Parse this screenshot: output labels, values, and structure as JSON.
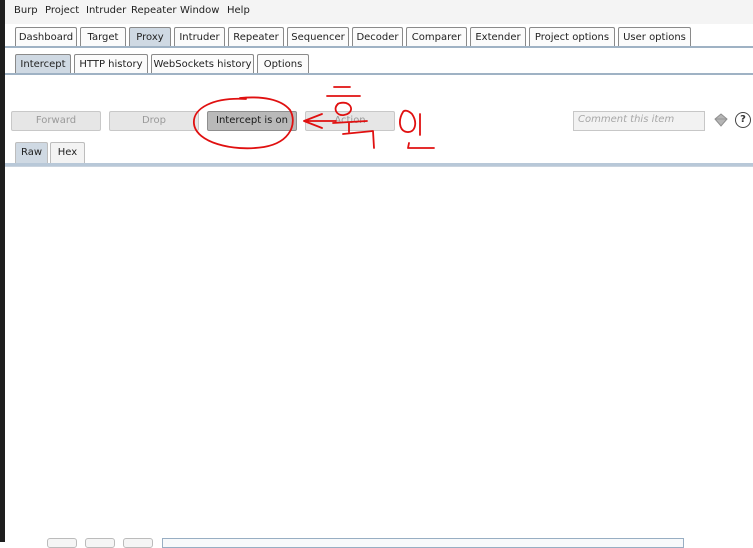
{
  "menubar": {
    "items": [
      "Burp",
      "Project",
      "Intruder",
      "Repeater",
      "Window",
      "Help"
    ]
  },
  "main_tabs": {
    "items": [
      "Dashboard",
      "Target",
      "Proxy",
      "Intruder",
      "Repeater",
      "Sequencer",
      "Decoder",
      "Comparer",
      "Extender",
      "Project options",
      "User options"
    ],
    "active": "Proxy"
  },
  "proxy_tabs": {
    "items": [
      "Intercept",
      "HTTP history",
      "WebSockets history",
      "Options"
    ],
    "active": "Intercept"
  },
  "toolbar": {
    "forward_label": "Forward",
    "drop_label": "Drop",
    "intercept_label": "Intercept is on",
    "action_label": "Action",
    "comment_placeholder": "Comment this item",
    "help_label": "?"
  },
  "view_tabs": {
    "items": [
      "Raw",
      "Hex"
    ],
    "active": "Raw"
  },
  "colors": {
    "annotation": "#e01010",
    "active_tab": "#cfd9e3",
    "intercept_on": "#b9b9b9"
  }
}
